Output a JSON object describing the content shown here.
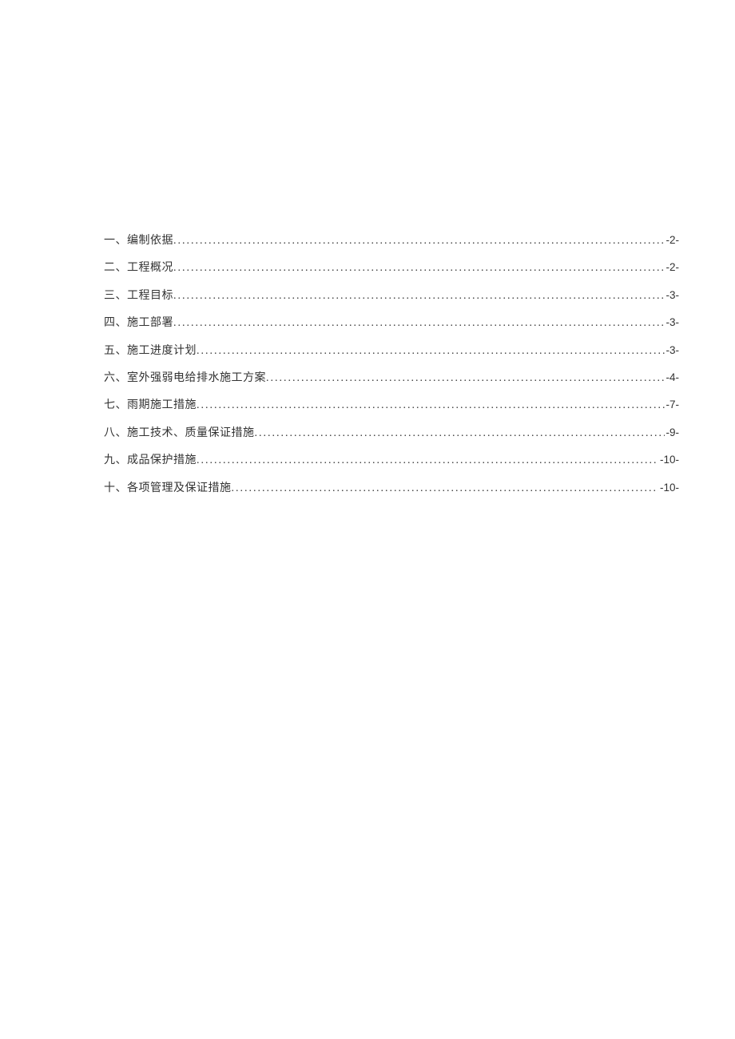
{
  "toc": {
    "items": [
      {
        "label": "一、编制依据",
        "page": "-2-"
      },
      {
        "label": "二、工程概况",
        "page": "-2-"
      },
      {
        "label": "三、工程目标",
        "page": "-3-"
      },
      {
        "label": "四、施工部署",
        "page": "-3-"
      },
      {
        "label": "五、施工进度计划",
        "page": "-3-"
      },
      {
        "label": "六、室外强弱电给排水施工方案",
        "page": "-4-"
      },
      {
        "label": "七、雨期施工措施",
        "page": "-7-"
      },
      {
        "label": "八、施工技术、质量保证措施",
        "page": "-9-"
      },
      {
        "label": "九、成品保护措施 ",
        "page": "-10-"
      },
      {
        "label": "十、各项管理及保证措施 ",
        "page": "-10-"
      }
    ]
  }
}
